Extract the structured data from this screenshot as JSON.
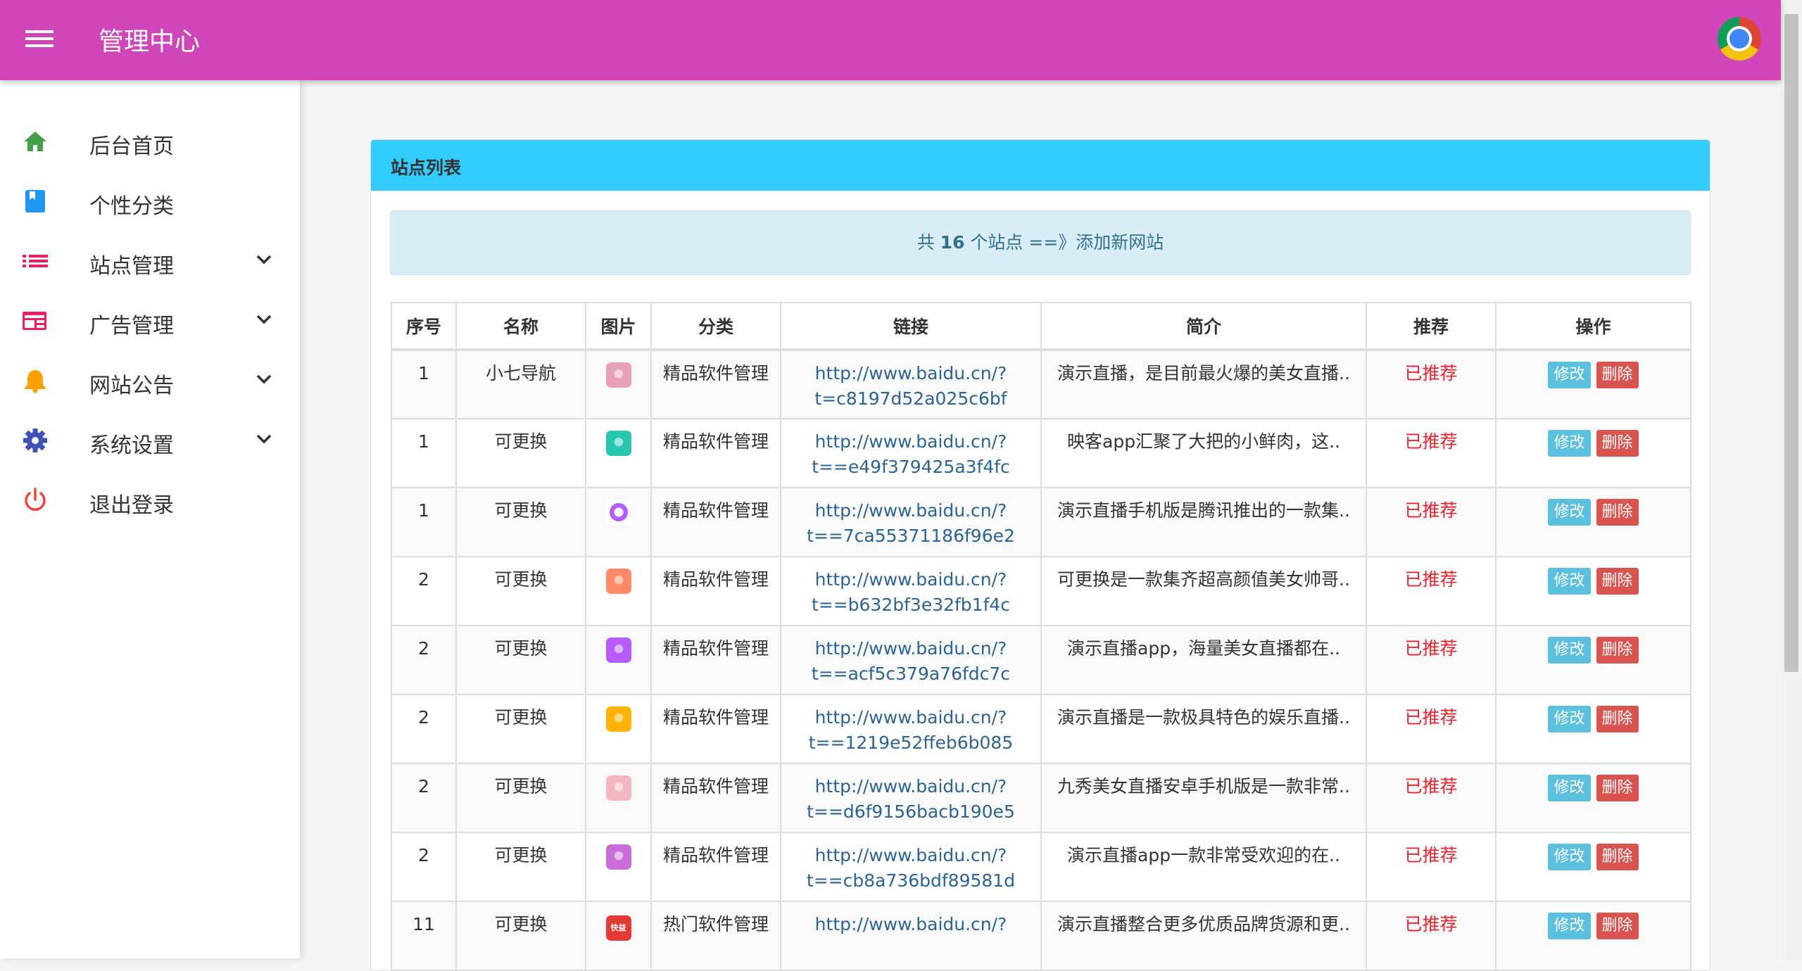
{
  "header": {
    "title": "管理中心"
  },
  "sidebar": {
    "items": [
      {
        "label": "后台首页",
        "icon": "home-icon",
        "color": "#43a047"
      },
      {
        "label": "个性分类",
        "icon": "book-icon",
        "color": "#2196f3"
      },
      {
        "label": "站点管理",
        "icon": "list-icon",
        "color": "#e91e63"
      },
      {
        "label": "广告管理",
        "icon": "ad-card-icon",
        "color": "#e91e63"
      },
      {
        "label": "网站公告",
        "icon": "bell-icon",
        "color": "#ffa000"
      },
      {
        "label": "系统设置",
        "icon": "gear-icon",
        "color": "#3f51b5"
      },
      {
        "label": "退出登录",
        "icon": "power-icon",
        "color": "#f44336"
      }
    ]
  },
  "panel": {
    "title": "站点列表",
    "summary": {
      "prefix": "共",
      "count": "16",
      "suffix": "个站点 ==》",
      "add_link": "添加新网站"
    }
  },
  "table": {
    "headers": [
      "序号",
      "名称",
      "图片",
      "分类",
      "链接",
      "简介",
      "推荐",
      "操作"
    ],
    "edit_label": "修改",
    "delete_label": "删除",
    "rows": [
      {
        "seq": "1",
        "name": "小七导航",
        "category": "精品软件管理",
        "url1": "http://www.baidu.cn/?",
        "url2": "t=c8197d52a025c6bf",
        "desc": "演示直播，是目前最火爆的美女直播..",
        "rec": "已推荐",
        "thumb": "#e8a0b8"
      },
      {
        "seq": "1",
        "name": "可更换",
        "category": "精品软件管理",
        "url1": "http://www.baidu.cn/?",
        "url2": "t==e49f379425a3f4fc",
        "desc": "映客app汇聚了大把的小鲜肉，这..",
        "rec": "已推荐",
        "thumb": "#26c6b0"
      },
      {
        "seq": "1",
        "name": "可更换",
        "category": "精品软件管理",
        "url1": "http://www.baidu.cn/?",
        "url2": "t==7ca55371186f96e2",
        "desc": "演示直播手机版是腾讯推出的一款集..",
        "rec": "已推荐",
        "thumb": "#ffffff"
      },
      {
        "seq": "2",
        "name": "可更换",
        "category": "精品软件管理",
        "url1": "http://www.baidu.cn/?",
        "url2": "t==b632bf3e32fb1f4c",
        "desc": "可更换是一款集齐超高颜值美女帅哥..",
        "rec": "已推荐",
        "thumb": "#ff8a65"
      },
      {
        "seq": "2",
        "name": "可更换",
        "category": "精品软件管理",
        "url1": "http://www.baidu.cn/?",
        "url2": "t==acf5c379a76fdc7c",
        "desc": "演示直播app，海量美女直播都在..",
        "rec": "已推荐",
        "thumb": "#b65cff"
      },
      {
        "seq": "2",
        "name": "可更换",
        "category": "精品软件管理",
        "url1": "http://www.baidu.cn/?",
        "url2": "t==1219e52ffeb6b085",
        "desc": "演示直播是一款极具特色的娱乐直播..",
        "rec": "已推荐",
        "thumb": "#ffb300"
      },
      {
        "seq": "2",
        "name": "可更换",
        "category": "精品软件管理",
        "url1": "http://www.baidu.cn/?",
        "url2": "t==d6f9156bacb190e5",
        "desc": "九秀美女直播安卓手机版是一款非常..",
        "rec": "已推荐",
        "thumb": "#f4b6c2"
      },
      {
        "seq": "2",
        "name": "可更换",
        "category": "精品软件管理",
        "url1": "http://www.baidu.cn/?",
        "url2": "t==cb8a736bdf89581d",
        "desc": "演示直播app一款非常受欢迎的在..",
        "rec": "已推荐",
        "thumb": "#c86dd7"
      },
      {
        "seq": "11",
        "name": "可更换",
        "category": "热门软件管理",
        "url1": "http://www.baidu.cn/?",
        "url2": "",
        "desc": "演示直播整合更多优质品牌货源和更..",
        "rec": "已推荐",
        "thumb": "#e53935",
        "thumb_text": "快益"
      }
    ]
  }
}
